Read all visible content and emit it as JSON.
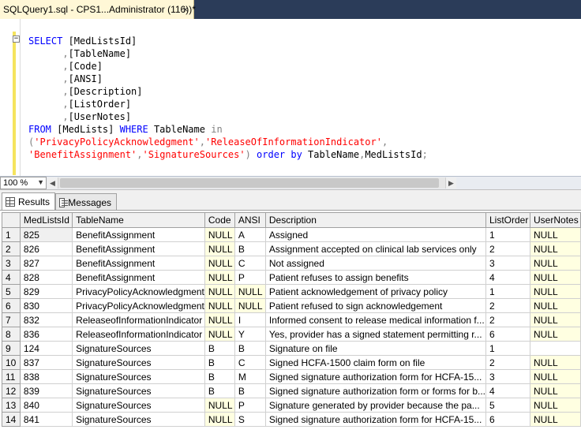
{
  "document_tab": {
    "title": "SQLQuery1.sql - CPS1...Administrator (116))*",
    "close_glyph": "×"
  },
  "editor": {
    "collapse_glyph": "−",
    "lines": [
      [
        {
          "t": "kw",
          "v": "SELECT"
        },
        {
          "t": "plain",
          "v": " [MedListsId]"
        }
      ],
      [
        {
          "t": "gray",
          "v": "      ,"
        },
        {
          "t": "plain",
          "v": "[TableName]"
        }
      ],
      [
        {
          "t": "gray",
          "v": "      ,"
        },
        {
          "t": "plain",
          "v": "[Code]"
        }
      ],
      [
        {
          "t": "gray",
          "v": "      ,"
        },
        {
          "t": "plain",
          "v": "[ANSI]"
        }
      ],
      [
        {
          "t": "gray",
          "v": "      ,"
        },
        {
          "t": "plain",
          "v": "[Description]"
        }
      ],
      [
        {
          "t": "gray",
          "v": "      ,"
        },
        {
          "t": "plain",
          "v": "[ListOrder]"
        }
      ],
      [
        {
          "t": "gray",
          "v": "      ,"
        },
        {
          "t": "plain",
          "v": "[UserNotes]"
        }
      ],
      [
        {
          "t": "kw",
          "v": "FROM"
        },
        {
          "t": "plain",
          "v": " [MedLists] "
        },
        {
          "t": "kw",
          "v": "WHERE"
        },
        {
          "t": "plain",
          "v": " TableName "
        },
        {
          "t": "gray",
          "v": "in"
        }
      ],
      [
        {
          "t": "gray",
          "v": "("
        },
        {
          "t": "str",
          "v": "'PrivacyPolicyAcknowledgment'"
        },
        {
          "t": "gray",
          "v": ","
        },
        {
          "t": "str",
          "v": "'ReleaseOfInformationIndicator'"
        },
        {
          "t": "gray",
          "v": ","
        }
      ],
      [
        {
          "t": "str",
          "v": "'BenefitAssignment'"
        },
        {
          "t": "gray",
          "v": ","
        },
        {
          "t": "str",
          "v": "'SignatureSources'"
        },
        {
          "t": "gray",
          "v": ")"
        },
        {
          "t": "plain",
          "v": " "
        },
        {
          "t": "kw",
          "v": "order by"
        },
        {
          "t": "plain",
          "v": " TableName"
        },
        {
          "t": "gray",
          "v": ","
        },
        {
          "t": "plain",
          "v": "MedListsId"
        },
        {
          "t": "gray",
          "v": ";"
        }
      ]
    ]
  },
  "zoom": {
    "value": "100 %",
    "arrow": "▼"
  },
  "hscroll": {
    "left": "◀",
    "right": "▶"
  },
  "results_tabs": [
    {
      "label": "Results",
      "active": true
    },
    {
      "label": "Messages",
      "active": false
    }
  ],
  "grid": {
    "columns": [
      "MedListsId",
      "TableName",
      "Code",
      "ANSI",
      "Description",
      "ListOrder",
      "UserNotes"
    ],
    "rows": [
      [
        "1",
        "825",
        "BenefitAssignment",
        "NULL",
        "A",
        "Assigned",
        "1",
        "NULL"
      ],
      [
        "2",
        "826",
        "BenefitAssignment",
        "NULL",
        "B",
        "Assignment accepted on clinical lab services only",
        "2",
        "NULL"
      ],
      [
        "3",
        "827",
        "BenefitAssignment",
        "NULL",
        "C",
        "Not assigned",
        "3",
        "NULL"
      ],
      [
        "4",
        "828",
        "BenefitAssignment",
        "NULL",
        "P",
        "Patient refuses to assign benefits",
        "4",
        "NULL"
      ],
      [
        "5",
        "829",
        "PrivacyPolicyAcknowledgment",
        "NULL",
        "NULL",
        "Patient acknowledgement of privacy policy",
        "1",
        "NULL"
      ],
      [
        "6",
        "830",
        "PrivacyPolicyAcknowledgment",
        "NULL",
        "NULL",
        "Patient refused to sign acknowledgement",
        "2",
        "NULL"
      ],
      [
        "7",
        "832",
        "ReleaseofInformationIndicator",
        "NULL",
        "I",
        "Informed consent to release medical information f...",
        "2",
        "NULL"
      ],
      [
        "8",
        "836",
        "ReleaseofInformationIndicator",
        "NULL",
        "Y",
        "Yes, provider has a signed statement permitting r...",
        "6",
        "NULL"
      ],
      [
        "9",
        "124",
        "SignatureSources",
        "B",
        "B",
        "Signature on file",
        "1",
        ""
      ],
      [
        "10",
        "837",
        "SignatureSources",
        "B",
        "C",
        "Signed HCFA-1500 claim form on file",
        "2",
        "NULL"
      ],
      [
        "11",
        "838",
        "SignatureSources",
        "B",
        "M",
        "Signed signature authorization form for HCFA-15...",
        "3",
        "NULL"
      ],
      [
        "12",
        "839",
        "SignatureSources",
        "B",
        "B",
        "Signed signature authorization form or forms for b...",
        "4",
        "NULL"
      ],
      [
        "13",
        "840",
        "SignatureSources",
        "NULL",
        "P",
        "Signature generated by provider because the pa...",
        "5",
        "NULL"
      ],
      [
        "14",
        "841",
        "SignatureSources",
        "NULL",
        "S",
        "Signed signature authorization form for HCFA-15...",
        "6",
        "NULL"
      ]
    ]
  }
}
